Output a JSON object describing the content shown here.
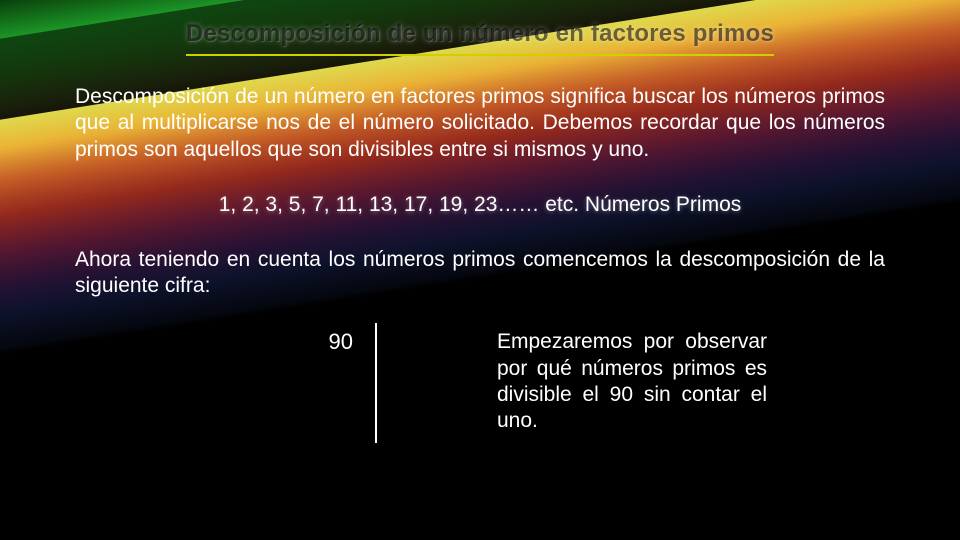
{
  "title": "Descomposición de un número en factores primos",
  "para1": "Descomposición de un número en factores primos significa buscar los números primos que al multiplicarse nos de el número solicitado. Debemos recordar que los números primos son aquellos que son divisibles entre si mismos y  uno.",
  "primes_line": "1, 2, 3, 5, 7, 11, 13, 17, 19, 23…… etc. Números Primos",
  "para2": "Ahora teniendo en cuenta los números primos comencemos la descomposición de la siguiente cifra:",
  "number": "90",
  "explain": "Empezaremos por observar por qué números primos es divisible el 90 sin contar el uno."
}
